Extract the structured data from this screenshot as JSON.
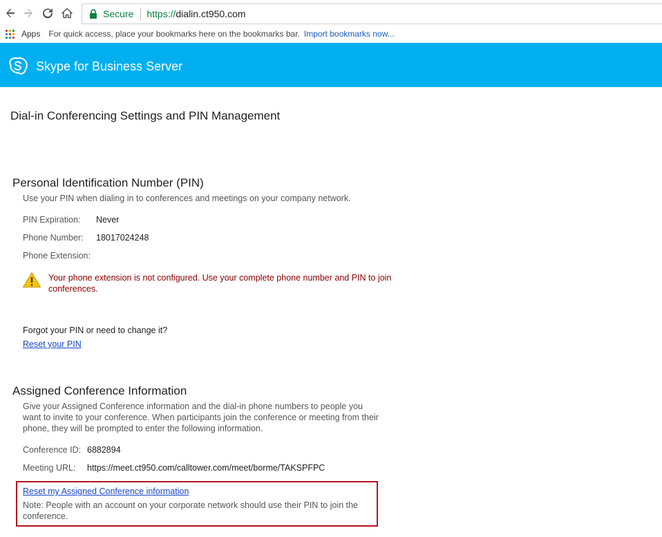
{
  "browser": {
    "secure_label": "Secure",
    "url_scheme": "https://",
    "url_rest": "dialin.ct950.com",
    "bookmarks_apps": "Apps",
    "bookmarks_hint": "For quick access, place your bookmarks here on the bookmarks bar.",
    "bookmarks_import": "Import bookmarks now..."
  },
  "banner": {
    "title": "Skype for Business Server",
    "color": "#00aff0"
  },
  "page": {
    "title": "Dial-in Conferencing Settings and PIN Management"
  },
  "pin_section": {
    "title": "Personal Identification Number (PIN)",
    "description": "Use your PIN when dialing in to conferences and meetings on your company network.",
    "expiration_label": "PIN Expiration:",
    "expiration_value": "Never",
    "phone_label": "Phone Number:",
    "phone_value": "18017024248",
    "extension_label": "Phone Extension:",
    "warning": "Your phone extension is not configured. Use your complete phone number and PIN to join conferences.",
    "forgot_question": "Forgot your PIN or need to change it?",
    "reset_link": "Reset your PIN"
  },
  "conference_section": {
    "title": "Assigned Conference Information",
    "description": "Give your Assigned Conference information and the dial-in phone numbers to people you want to invite to your conference. When participants join the conference or meeting from their phone, they will be prompted to enter the following information.",
    "conference_id_label": "Conference ID:",
    "conference_id_value": "6882894",
    "meeting_url_label": "Meeting URL:",
    "meeting_url_value": "https://meet.ct950.com/calltower.com/meet/borme/TAKSPFPC",
    "reset_link": "Reset my Assigned Conference information",
    "note": "Note: People with an account on your corporate network should use their PIN to join the conference."
  },
  "colors": {
    "warning_text": "#8b0000",
    "link": "#1a47c7",
    "highlight_border": "#b0161f"
  }
}
